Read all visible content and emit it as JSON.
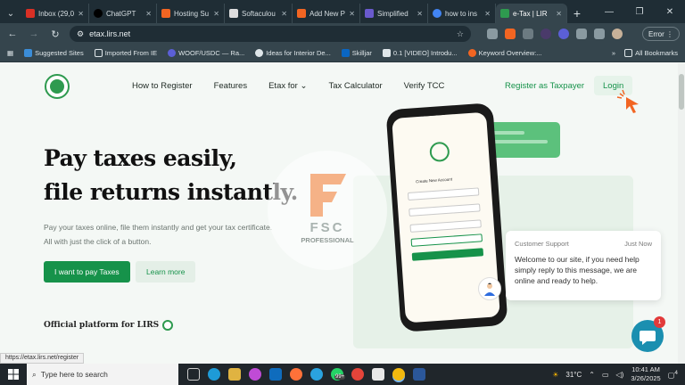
{
  "browser": {
    "tabs": [
      {
        "label": "Inbox (29,0",
        "color": "#d93025"
      },
      {
        "label": "ChatGPT",
        "color": "#000000"
      },
      {
        "label": "Hosting Su",
        "color": "#f26522"
      },
      {
        "label": "Softaculou",
        "color": "#dddddd"
      },
      {
        "label": "Add New P",
        "color": "#f26522"
      },
      {
        "label": "Simplified",
        "color": "#6a5acd"
      },
      {
        "label": "how to ins",
        "color": "#4285f4"
      },
      {
        "label": "e-Tax | LIR",
        "color": "#2e9a4f",
        "active": true
      }
    ],
    "new_tab": "+",
    "url": "etax.lirs.net",
    "error_label": "Error",
    "bookmarks": [
      "Suggested Sites",
      "Imported From IE",
      "WOOF/USDC — Ra...",
      "Ideas for Interior De...",
      "Skilljar",
      "0.1 [VIDEO] Introdu...",
      "Keyword Overview:..."
    ],
    "bookmarks_more": "»",
    "all_bookmarks": "All Bookmarks",
    "status_url": "https://etax.lirs.net/register"
  },
  "site": {
    "nav": [
      "How to Register",
      "Features",
      "Etax for",
      "Tax Calculator",
      "Verify TCC"
    ],
    "register_label": "Register as Taxpayer",
    "login_label": "Login",
    "headline_1": "Pay taxes easily,",
    "headline_2": "file returns instantly.",
    "sub_1": "Pay your taxes online, file them instantly and get your tax certificate.",
    "sub_2": "All with just the click of a button.",
    "primary_btn": "I want to pay Taxes",
    "secondary_btn": "Learn more",
    "official": "Official platform for LIRS",
    "phone_title": "Create New Account",
    "watermark_fsc": "FSC",
    "watermark_pro": "PROFESSIONAL"
  },
  "support": {
    "header": "Customer Support",
    "time": "Just Now",
    "message": "Welcome to our site, if you need help simply reply to this message, we are online and ready to help.",
    "badge": "1"
  },
  "taskbar": {
    "search_placeholder": "Type here to search",
    "temp": "31°C",
    "time": "10:41 AM",
    "date": "3/26/2025",
    "notif": "4",
    "whatsapp_badge": "99+"
  }
}
